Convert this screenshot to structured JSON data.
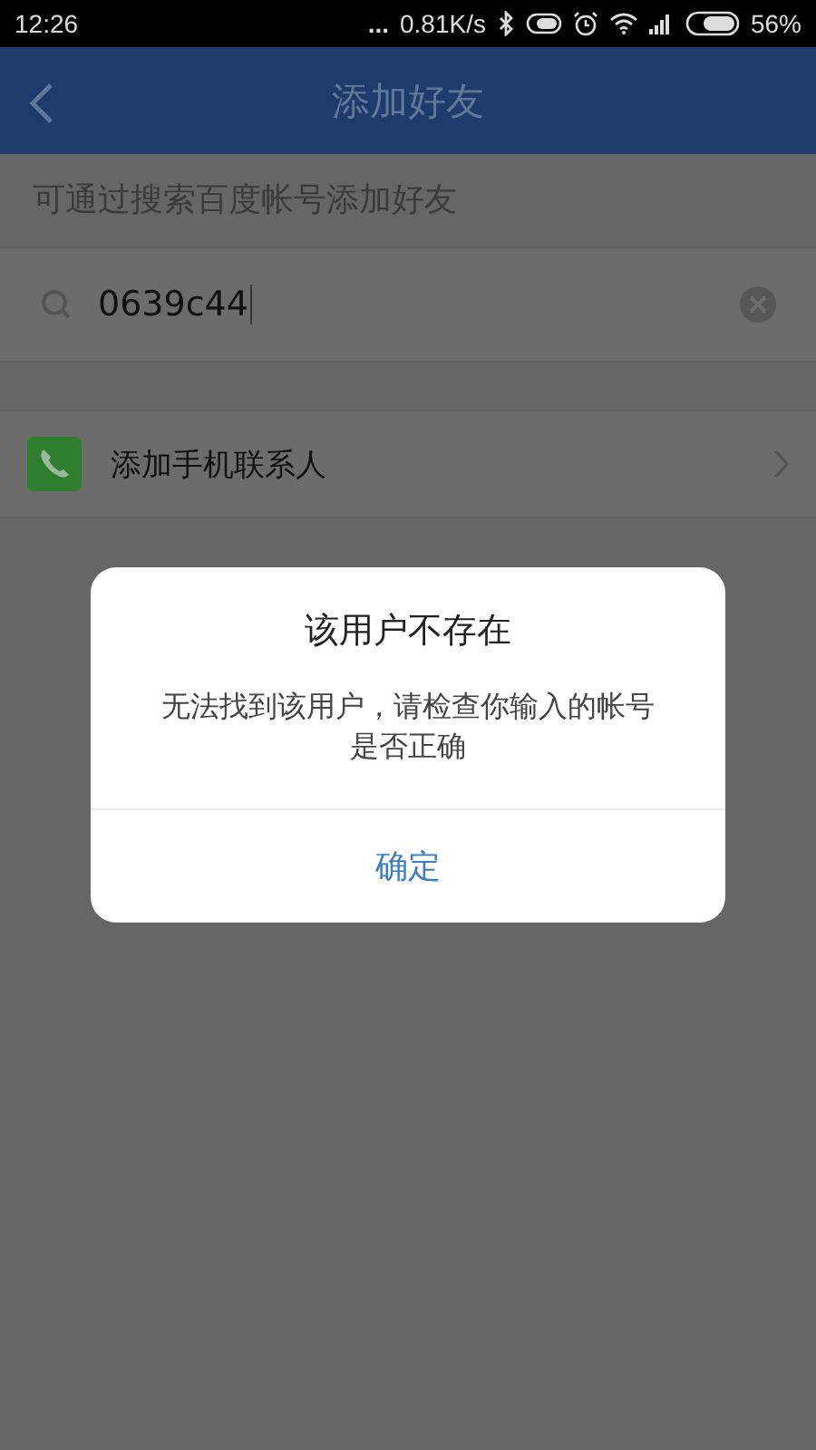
{
  "status_bar": {
    "time": "12:26",
    "dots": "...",
    "speed": "0.81K/s",
    "battery": "56%"
  },
  "header": {
    "title": "添加好友"
  },
  "hint": "可通过搜索百度帐号添加好友",
  "search": {
    "value": "0639c44"
  },
  "menu_items": [
    {
      "label": "添加手机联系人"
    }
  ],
  "dialog": {
    "title": "该用户不存在",
    "message": "无法找到该用户，请检查你输入的帐号是否正确",
    "button": "确定"
  }
}
